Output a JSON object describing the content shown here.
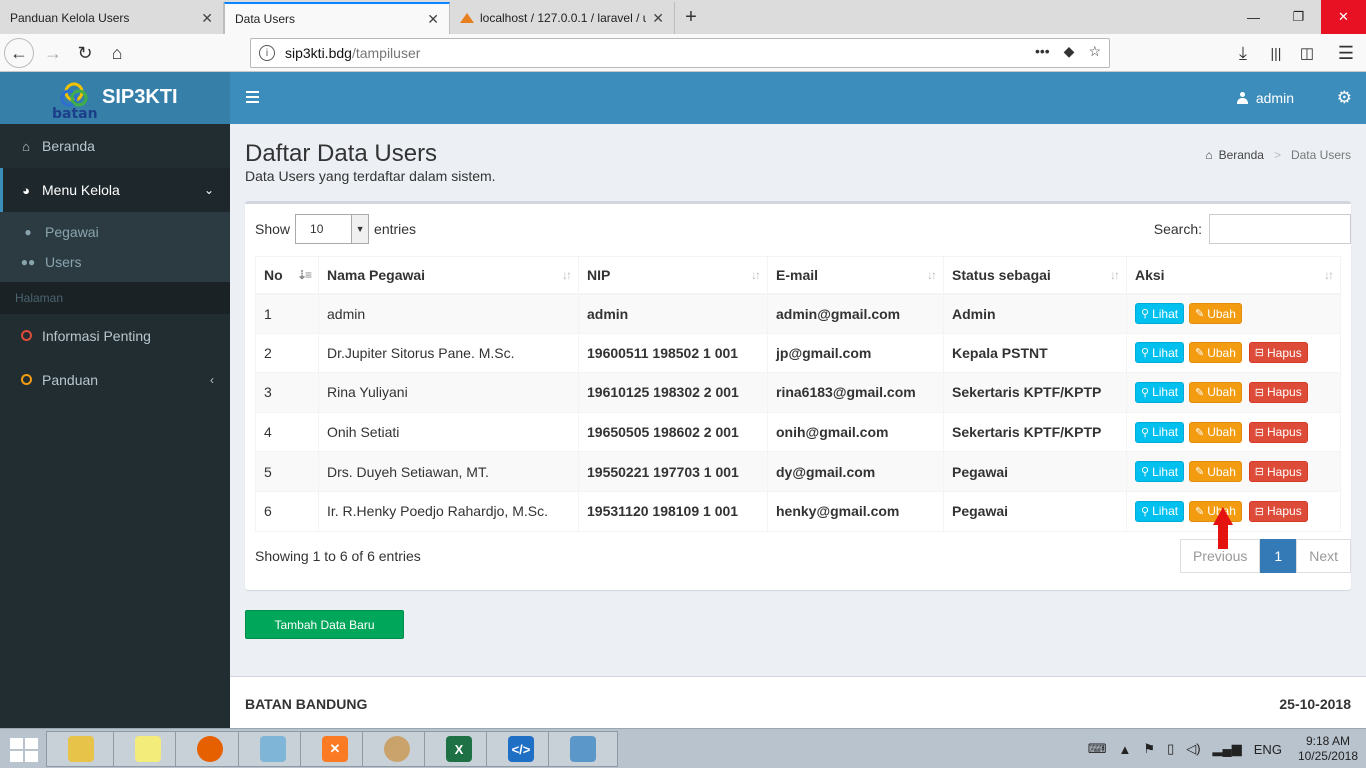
{
  "browser": {
    "tabs": [
      {
        "title": "Panduan Kelola Users"
      },
      {
        "title": "Data Users"
      },
      {
        "title": "localhost / 127.0.0.1 / laravel / u"
      }
    ],
    "url_host": "sip3kti.bdg",
    "url_path": "/tampiluser"
  },
  "app": {
    "logo_text": "SIP3KTI",
    "logo_sub": "batan",
    "user_name": "admin"
  },
  "sidebar": {
    "beranda": "Beranda",
    "menu_kelola": "Menu Kelola",
    "sub_items": [
      {
        "label": "Pegawai",
        "icon": "user-icon"
      },
      {
        "label": "Users",
        "icon": "users-icon"
      }
    ],
    "header": "Halaman",
    "informasi": "Informasi Penting",
    "panduan": "Panduan"
  },
  "page": {
    "title": "Daftar Data Users",
    "subtitle": "Data Users yang terdaftar dalam sistem.",
    "breadcrumb_home": "Beranda",
    "breadcrumb_current": "Data Users"
  },
  "table": {
    "show_label": "Show",
    "entries_value": "10",
    "entries_label": "entries",
    "search_label": "Search:",
    "columns": [
      "No",
      "Nama Pegawai",
      "NIP",
      "E-mail",
      "Status sebagai",
      "Aksi"
    ],
    "rows": [
      {
        "no": "1",
        "nama": "admin",
        "nip": "admin",
        "email": "admin@gmail.com",
        "status": "Admin",
        "deletable": false
      },
      {
        "no": "2",
        "nama": "Dr.Jupiter Sitorus Pane. M.Sc.",
        "nip": "19600511 198502 1 001",
        "email": "jp@gmail.com",
        "status": "Kepala PSTNT",
        "deletable": true
      },
      {
        "no": "3",
        "nama": "Rina Yuliyani",
        "nip": "19610125 198302 2 001",
        "email": "rina6183@gmail.com",
        "status": "Sekertaris KPTF/KPTP",
        "deletable": true
      },
      {
        "no": "4",
        "nama": "Onih Setiati",
        "nip": "19650505 198602 2 001",
        "email": "onih@gmail.com",
        "status": "Sekertaris KPTF/KPTP",
        "deletable": true
      },
      {
        "no": "5",
        "nama": "Drs. Duyeh Setiawan, MT.",
        "nip": "19550221 197703 1 001",
        "email": "dy@gmail.com",
        "status": "Pegawai",
        "deletable": true
      },
      {
        "no": "6",
        "nama": "Ir. R.Henky Poedjo Rahardjo, M.Sc.",
        "nip": "19531120 198109 1 001",
        "email": "henky@gmail.com",
        "status": "Pegawai",
        "deletable": true
      }
    ],
    "btn_lihat": "Lihat",
    "btn_ubah": "Ubah",
    "btn_hapus": "Hapus",
    "info": "Showing 1 to 6 of 6 entries",
    "prev": "Previous",
    "page": "1",
    "next": "Next"
  },
  "add_button": "Tambah Data Baru",
  "footer": {
    "left": "BATAN BANDUNG",
    "right": "25-10-2018"
  },
  "taskbar": {
    "lang": "ENG",
    "time": "9:18 AM",
    "date": "10/25/2018"
  },
  "colors": {
    "header": "#3c8dbc",
    "sidebar": "#222d32",
    "info": "#00c0ef",
    "warning": "#f39c12",
    "danger": "#dd4b39",
    "success": "#00a65a"
  }
}
